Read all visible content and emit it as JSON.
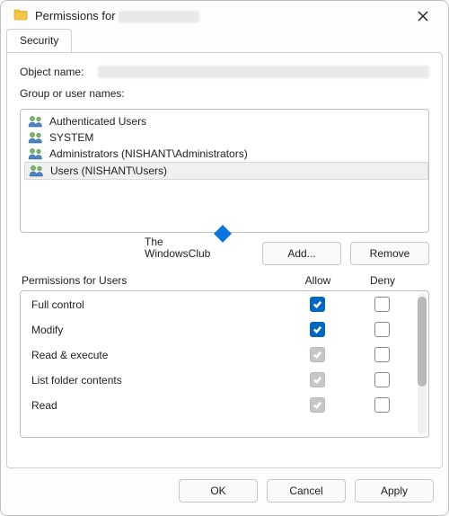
{
  "window": {
    "title_prefix": "Permissions for",
    "close_tooltip": "Close"
  },
  "tabs": {
    "security": "Security"
  },
  "labels": {
    "object_name": "Object name:",
    "group_or_user_names": "Group or user names:",
    "permissions_for": "Permissions for Users",
    "allow": "Allow",
    "deny": "Deny"
  },
  "groups": [
    {
      "name": "Authenticated Users",
      "selected": false
    },
    {
      "name": "SYSTEM",
      "selected": false
    },
    {
      "name": "Administrators (NISHANT\\Administrators)",
      "selected": false
    },
    {
      "name": "Users (NISHANT\\Users)",
      "selected": true
    }
  ],
  "buttons": {
    "add": "Add...",
    "remove": "Remove",
    "ok": "OK",
    "cancel": "Cancel",
    "apply": "Apply"
  },
  "permissions": [
    {
      "label": "Full control",
      "allow": "checked-blue",
      "deny": "unchecked"
    },
    {
      "label": "Modify",
      "allow": "checked-blue",
      "deny": "unchecked"
    },
    {
      "label": "Read & execute",
      "allow": "checked-gray",
      "deny": "unchecked"
    },
    {
      "label": "List folder contents",
      "allow": "checked-gray",
      "deny": "unchecked"
    },
    {
      "label": "Read",
      "allow": "checked-gray",
      "deny": "unchecked"
    }
  ],
  "watermark": {
    "line1": "The",
    "line2": "WindowsClub"
  }
}
